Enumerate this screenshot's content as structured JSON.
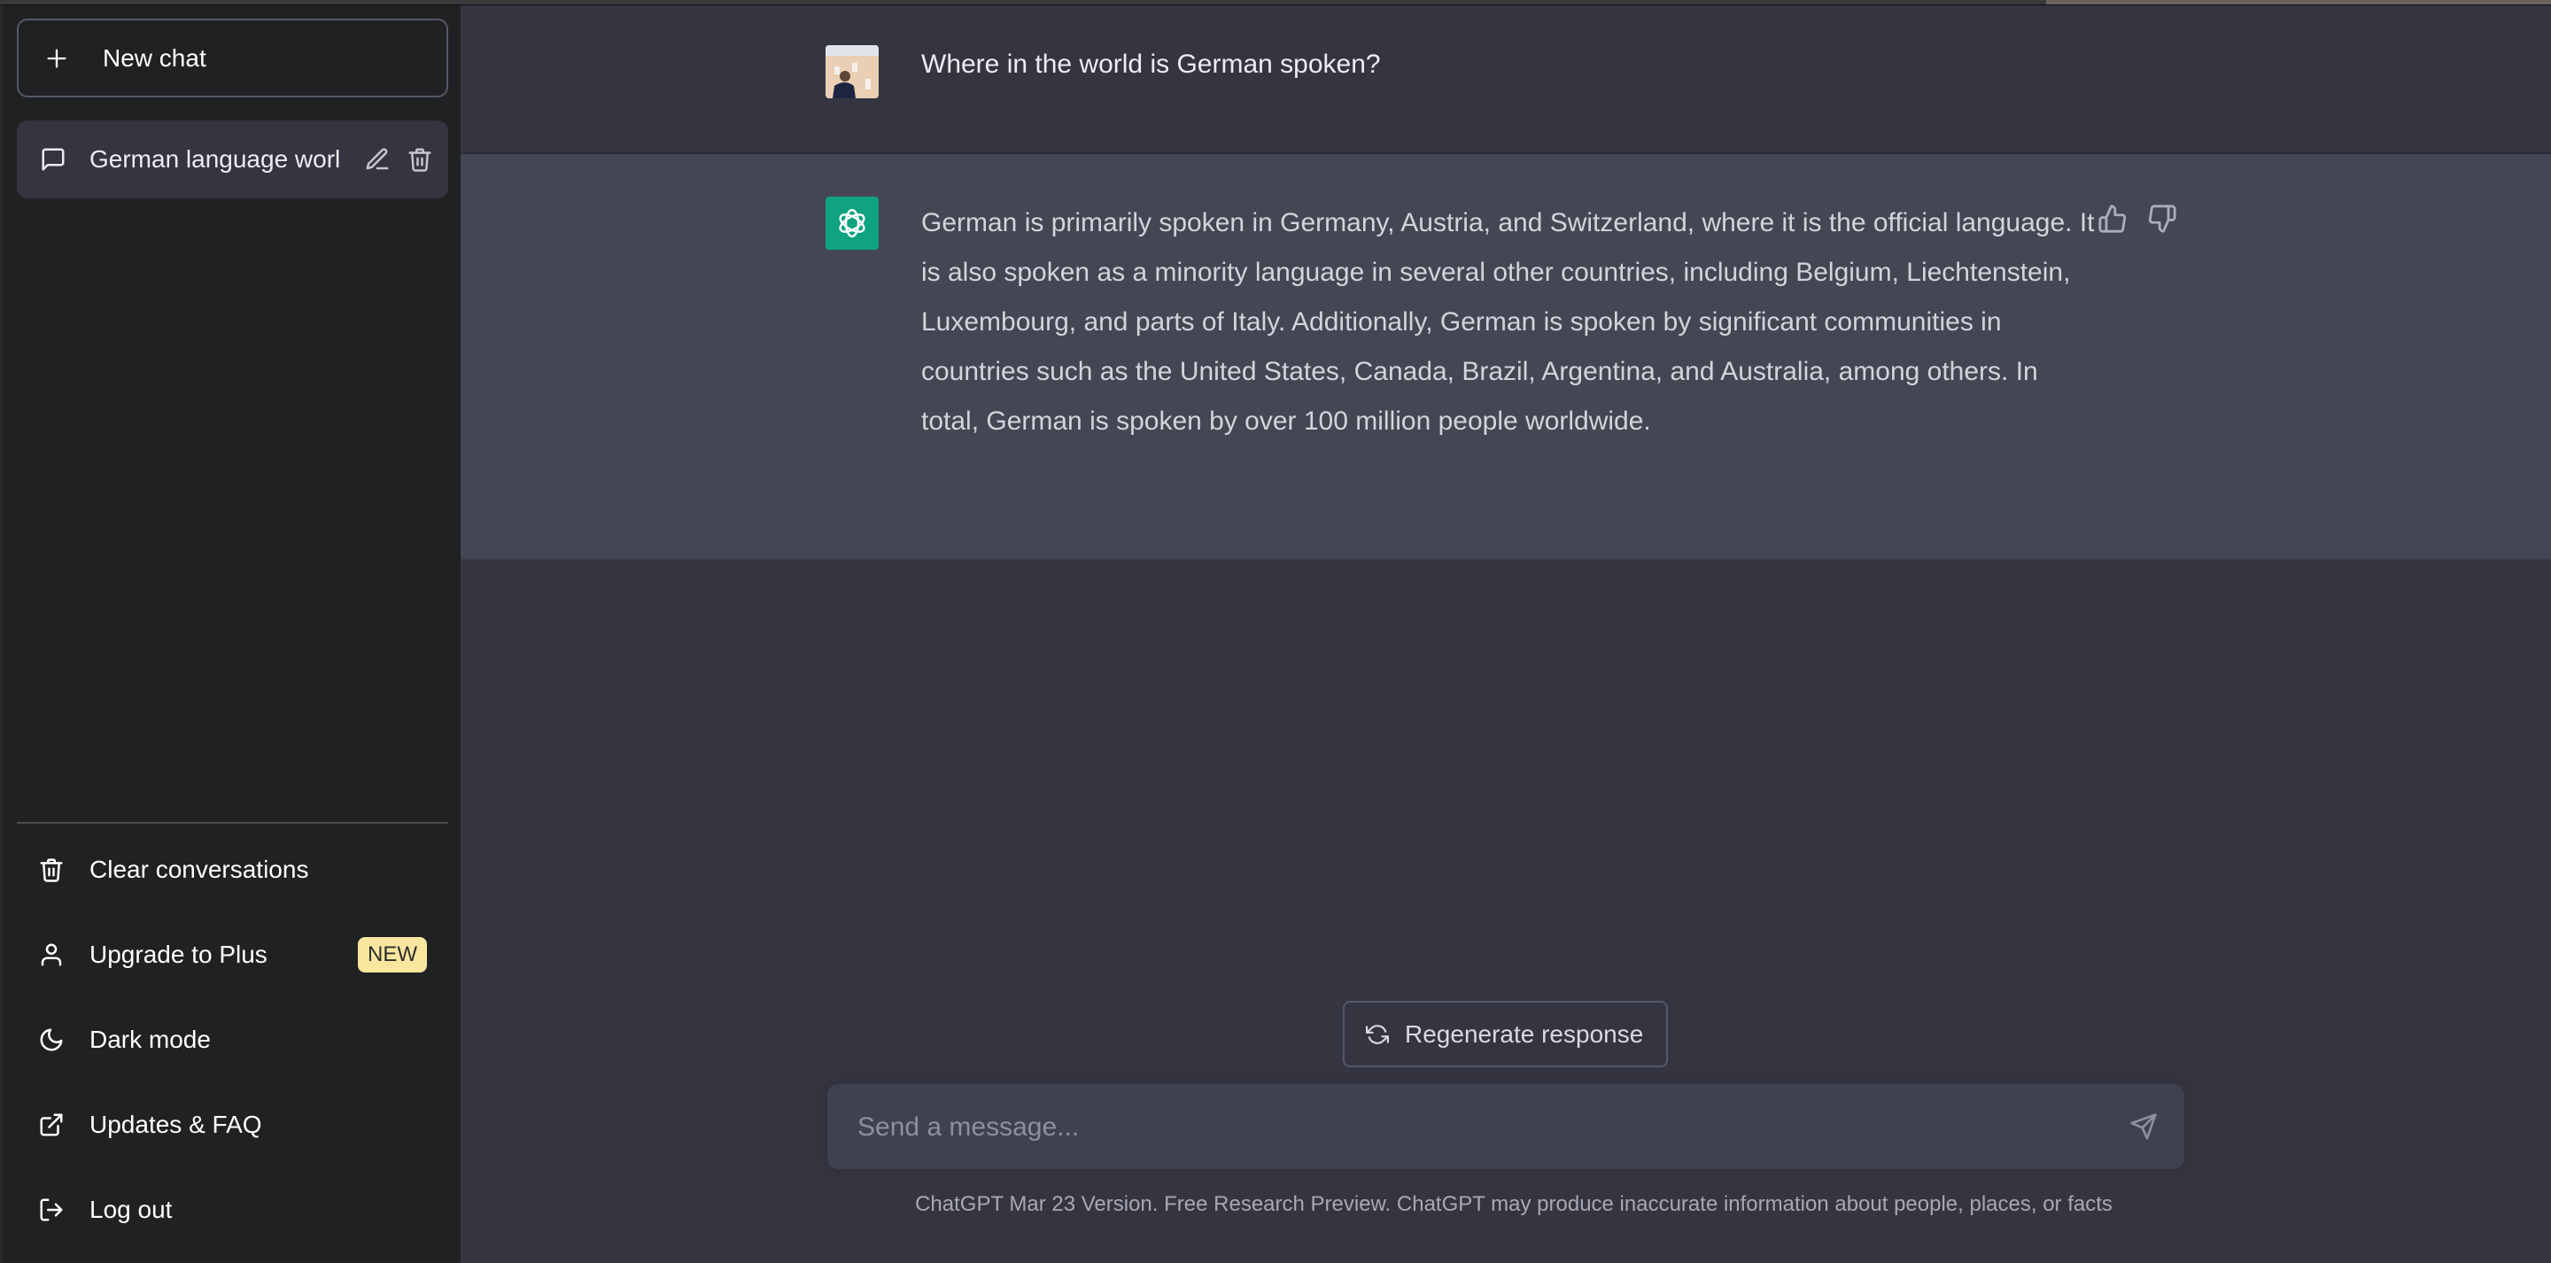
{
  "sidebar": {
    "new_chat_label": "New chat",
    "conversations": [
      {
        "title": "German language worl"
      }
    ],
    "menu": [
      {
        "label": "Clear conversations",
        "icon": "trash-icon"
      },
      {
        "label": "Upgrade to Plus",
        "icon": "user-icon",
        "badge": "NEW"
      },
      {
        "label": "Dark mode",
        "icon": "moon-icon"
      },
      {
        "label": "Updates & FAQ",
        "icon": "external-link-icon"
      },
      {
        "label": "Log out",
        "icon": "logout-icon"
      }
    ]
  },
  "conversation": {
    "user_message": "Where in the world is German spoken?",
    "assistant_message": "German is primarily spoken in Germany, Austria, and Switzerland, where it is the official language. It is also spoken as a minority language in several other countries, including Belgium, Liechtenstein, Luxembourg, and parts of Italy. Additionally, German is spoken by significant communities in countries such as the United States, Canada, Brazil, Argentina, and Australia, among others. In total, German is spoken by over 100 million people worldwide."
  },
  "composer": {
    "regenerate_label": "Regenerate response",
    "placeholder": "Send a message..."
  },
  "footer": {
    "version_link": "ChatGPT Mar 23 Version",
    "disclaimer": ". Free Research Preview. ChatGPT may produce inaccurate information about people, places, or facts"
  },
  "colors": {
    "sidebar_bg": "#202123",
    "main_bg": "#343541",
    "assistant_row_bg": "#444654",
    "brand_green": "#10a37f",
    "badge_bg": "#fae69e"
  }
}
